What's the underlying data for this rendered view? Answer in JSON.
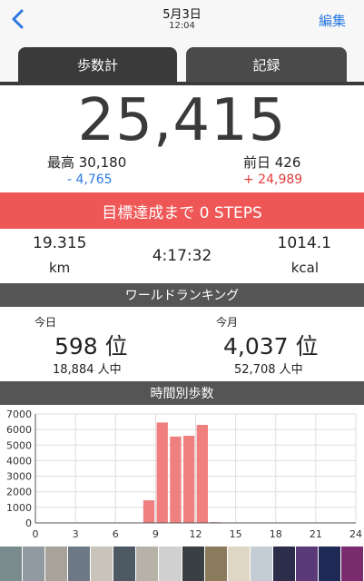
{
  "nav": {
    "date": "5月3日",
    "time": "12:04",
    "edit_label": "編集"
  },
  "tabs": [
    {
      "label": "歩数計"
    },
    {
      "label": "記録"
    }
  ],
  "summary": {
    "steps": "25,415",
    "best_label": "最高 30,180",
    "best_diff": "- 4,765",
    "prev_label": "前日 426",
    "prev_diff": "+ 24,989"
  },
  "goal_text": "目標達成まで 0 STEPS",
  "stats": {
    "distance": "19.315",
    "distance_unit": "km",
    "time": "4:17:32",
    "calories": "1014.1",
    "calories_unit": "kcal"
  },
  "ranking": {
    "title": "ワールドランキング",
    "today": {
      "label": "今日",
      "rank": "598 位",
      "sub": "18,884 人中"
    },
    "month": {
      "label": "今月",
      "rank": "4,037 位",
      "sub": "52,708 人中"
    }
  },
  "hourly_title": "時間別歩数",
  "chart_data": {
    "type": "bar",
    "x": [
      0,
      1,
      2,
      3,
      4,
      5,
      6,
      7,
      8,
      9,
      10,
      11,
      12,
      13,
      14,
      15,
      16,
      17,
      18,
      19,
      20,
      21,
      22,
      23
    ],
    "values": [
      0,
      0,
      0,
      0,
      0,
      0,
      0,
      0,
      1450,
      6450,
      5550,
      5600,
      6300,
      50,
      0,
      0,
      0,
      0,
      0,
      0,
      0,
      0,
      0,
      0
    ],
    "xticks": [
      0,
      3,
      6,
      9,
      12,
      15,
      18,
      21,
      24
    ],
    "yticks": [
      0,
      1000,
      2000,
      3000,
      4000,
      5000,
      6000,
      7000
    ],
    "xlim": [
      0,
      24
    ],
    "ylim": [
      0,
      7000
    ],
    "grid": true,
    "bar_color": "#f08080"
  }
}
